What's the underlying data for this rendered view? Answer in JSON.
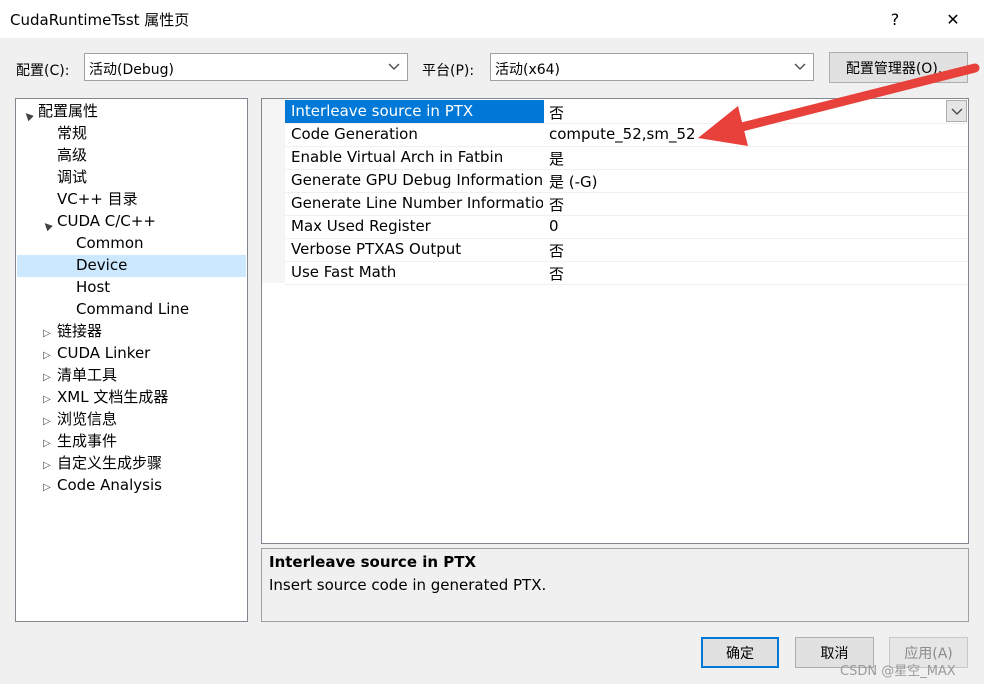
{
  "window": {
    "title": "CudaRuntimeTsst 属性页",
    "help_label": "?",
    "close_label": "✕"
  },
  "toolbar": {
    "config_label": "配置(C):",
    "config_value": "活动(Debug)",
    "platform_label": "平台(P):",
    "platform_value": "活动(x64)",
    "config_manager_label": "配置管理器(O)..."
  },
  "tree": {
    "items": [
      {
        "label": "配置属性",
        "expander": "▲",
        "level": 0
      },
      {
        "label": "常规",
        "expander": "",
        "level": 1
      },
      {
        "label": "高级",
        "expander": "",
        "level": 1
      },
      {
        "label": "调试",
        "expander": "",
        "level": 1
      },
      {
        "label": "VC++ 目录",
        "expander": "",
        "level": 1
      },
      {
        "label": "CUDA C/C++",
        "expander": "▲",
        "level": 1
      },
      {
        "label": "Common",
        "expander": "",
        "level": 2
      },
      {
        "label": "Device",
        "expander": "",
        "level": 2,
        "selected": true
      },
      {
        "label": "Host",
        "expander": "",
        "level": 2
      },
      {
        "label": "Command Line",
        "expander": "",
        "level": 2
      },
      {
        "label": "链接器",
        "expander": "▷",
        "level": 1
      },
      {
        "label": "CUDA Linker",
        "expander": "▷",
        "level": 1
      },
      {
        "label": "清单工具",
        "expander": "▷",
        "level": 1
      },
      {
        "label": "XML 文档生成器",
        "expander": "▷",
        "level": 1
      },
      {
        "label": "浏览信息",
        "expander": "▷",
        "level": 1
      },
      {
        "label": "生成事件",
        "expander": "▷",
        "level": 1
      },
      {
        "label": "自定义生成步骤",
        "expander": "▷",
        "level": 1
      },
      {
        "label": "Code Analysis",
        "expander": "▷",
        "level": 1
      }
    ]
  },
  "grid": {
    "rows": [
      {
        "name": "Interleave source in PTX",
        "value": "否",
        "selected": true
      },
      {
        "name": "Code Generation",
        "value": "compute_52,sm_52"
      },
      {
        "name": "Enable Virtual Arch in Fatbin",
        "value": "是"
      },
      {
        "name": "Generate GPU Debug Information",
        "value": "是 (-G)"
      },
      {
        "name": "Generate Line Number Information",
        "value": "否"
      },
      {
        "name": "Max Used Register",
        "value": "0"
      },
      {
        "name": "Verbose PTXAS Output",
        "value": "否"
      },
      {
        "name": "Use Fast Math",
        "value": "否"
      }
    ]
  },
  "description": {
    "title": "Interleave source in PTX",
    "text": "Insert source code in generated PTX."
  },
  "footer": {
    "ok_label": "确定",
    "cancel_label": "取消",
    "apply_label": "应用(A)"
  },
  "watermark": "CSDN @星空_MAX",
  "colors": {
    "selection": "#0078d7",
    "tree_selection": "#cce8ff",
    "annotation_arrow": "#e8413b"
  }
}
